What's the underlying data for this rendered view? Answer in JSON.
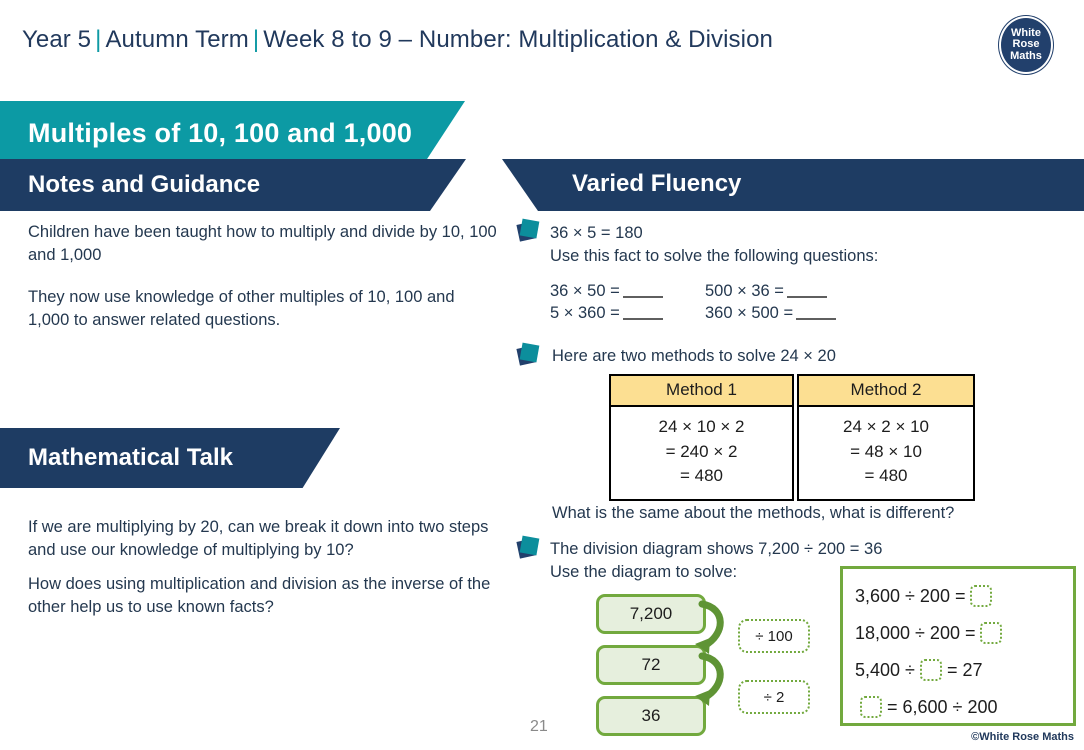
{
  "header": {
    "year": "Year 5",
    "term": "Autumn Term",
    "week": "Week 8 to 9 – Number: Multiplication & Division",
    "separator": "|",
    "logo": {
      "line1": "White",
      "line2": "Rose",
      "line3": "Maths"
    }
  },
  "lesson_title": "Multiples of 10, 100 and 1,000",
  "sections": {
    "notes_title": "Notes and Guidance",
    "varied_fluency_title": "Varied Fluency",
    "maths_talk_title": "Mathematical Talk"
  },
  "notes": [
    "Children have been taught how to multiply and divide by 10, 100 and 1,000",
    "They now use knowledge of other multiples of 10, 100 and 1,000 to answer related questions."
  ],
  "maths_talk": [
    "If we are multiplying by 20, can we break it down into two steps and use our knowledge of multiplying by 10?",
    "How does using multiplication and division as the inverse of the other help us to use known facts?"
  ],
  "varied_fluency": {
    "q1": {
      "fact": "36 × 5 = 180",
      "instruction": "Use this fact to solve the following questions:",
      "equations": [
        {
          "left": "36 × 50 =",
          "right": "500 × 36 ="
        },
        {
          "left": "5 × 360 =",
          "right": "360 × 500 ="
        }
      ]
    },
    "q2": {
      "prompt": "Here are two methods to solve 24 × 20",
      "tables": [
        {
          "header": "Method 1",
          "lines": [
            "24 × 10 × 2",
            "= 240 × 2",
            "= 480"
          ]
        },
        {
          "header": "Method 2",
          "lines": [
            "24 × 2 × 10",
            "= 48 × 10",
            "= 480"
          ]
        }
      ],
      "follow_up": "What is the same about the methods, what is different?"
    },
    "q3": {
      "prompt_line1": "The division diagram shows 7,200 ÷ 200 = 36",
      "prompt_line2": "Use the diagram to solve:",
      "diagram": {
        "boxes": [
          "7,200",
          "72",
          "36"
        ],
        "labels": [
          "÷ 100",
          "÷ 2"
        ]
      },
      "answers": [
        {
          "a": "3,600 ÷ 200 =",
          "b": ""
        },
        {
          "a": "18,000 ÷ 200 =",
          "b": ""
        },
        {
          "a": "5,400 ÷",
          "b": "= 27"
        },
        {
          "a": "",
          "b": "= 6,600 ÷ 200"
        }
      ]
    }
  },
  "footer": {
    "page_number": "21",
    "copyright": "©White Rose Maths"
  },
  "colors": {
    "teal": "#0c9aa4",
    "navy": "#1e3c63",
    "amber": "#fcdf92",
    "green": "#72a93e",
    "green_fill": "#e6efdd"
  }
}
